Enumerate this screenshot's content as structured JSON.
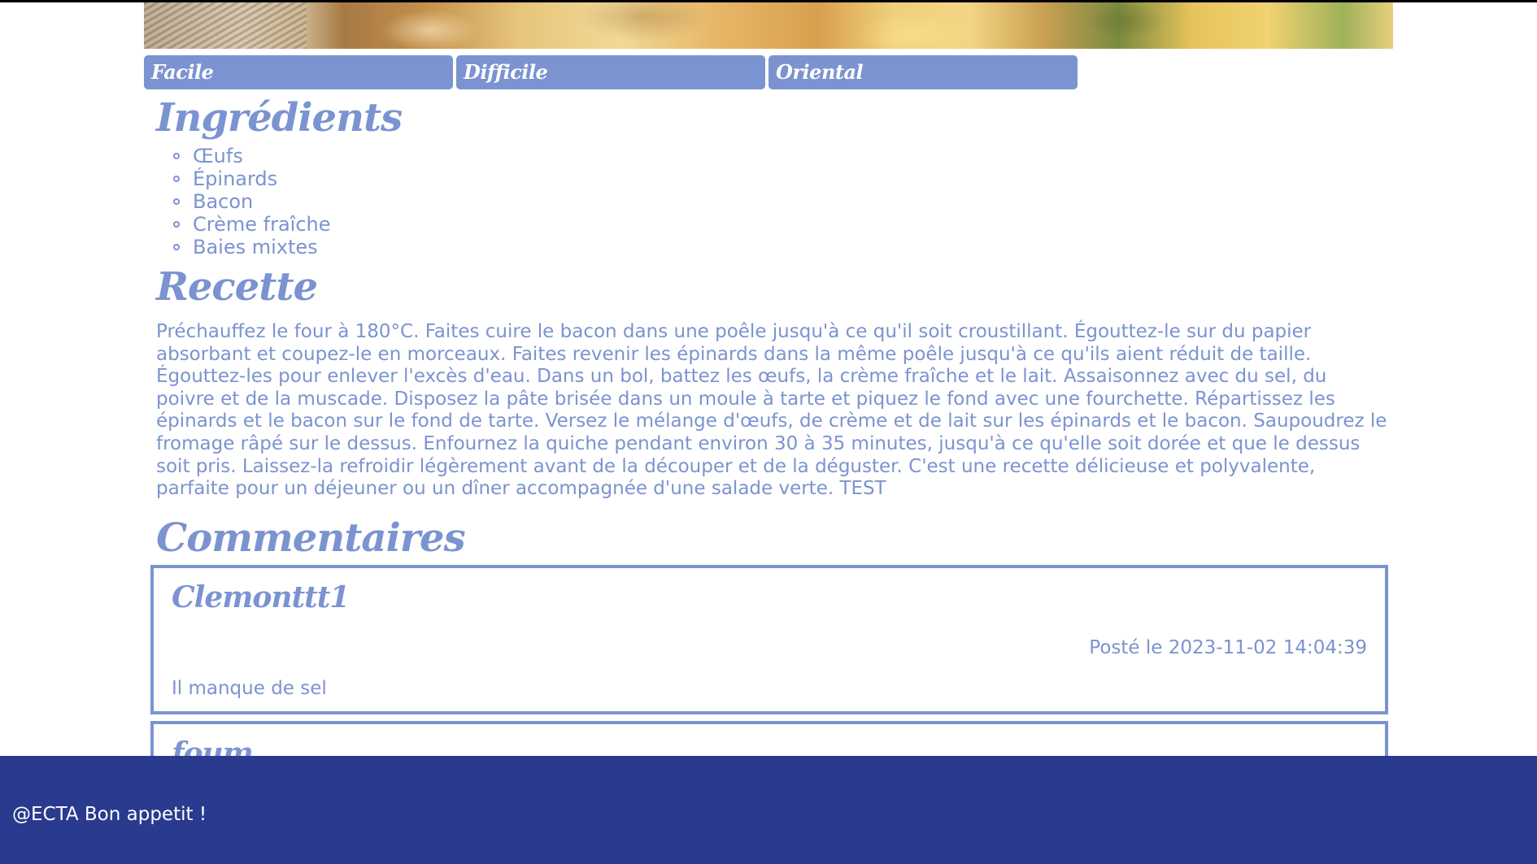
{
  "nav": {
    "tabs": [
      {
        "label": "Facile"
      },
      {
        "label": "Difficile"
      },
      {
        "label": "Oriental"
      }
    ]
  },
  "ingredients": {
    "title": "Ingrédients",
    "items": [
      "Œufs",
      "Épinards",
      "Bacon",
      "Crème fraîche",
      "Baies mixtes"
    ]
  },
  "recipe": {
    "title": "Recette",
    "text": "Préchauffez le four à 180°C. Faites cuire le bacon dans une poêle jusqu'à ce qu'il soit croustillant. Égouttez-le sur du papier absorbant et coupez-le en morceaux. Faites revenir les épinards dans la même poêle jusqu'à ce qu'ils aient réduit de taille. Égouttez-les pour enlever l'excès d'eau. Dans un bol, battez les œufs, la crème fraîche et le lait. Assaisonnez avec du sel, du poivre et de la muscade. Disposez la pâte brisée dans un moule à tarte et piquez le fond avec une fourchette. Répartissez les épinards et le bacon sur le fond de tarte. Versez le mélange d'œufs, de crème et de lait sur les épinards et le bacon. Saupoudrez le fromage râpé sur le dessus. Enfournez la quiche pendant environ 30 à 35 minutes, jusqu'à ce qu'elle soit dorée et que le dessus soit pris. Laissez-la refroidir légèrement avant de la découper et de la déguster. C'est une recette délicieuse et polyvalente, parfaite pour un déjeuner ou un dîner accompagnée d'une salade verte. TEST"
  },
  "comments": {
    "title": "Commentaires",
    "items": [
      {
        "author": "Clemonttt1",
        "date": "Posté le 2023-11-02 14:04:39",
        "body": "Il manque de sel"
      },
      {
        "author": "foum",
        "date": "",
        "body": ""
      }
    ]
  },
  "footer": {
    "text": "@ECTA Bon appetit !"
  },
  "colors": {
    "accent": "#7b93d0",
    "footer_bg": "#2a3a8f",
    "background": "#ffffff"
  }
}
